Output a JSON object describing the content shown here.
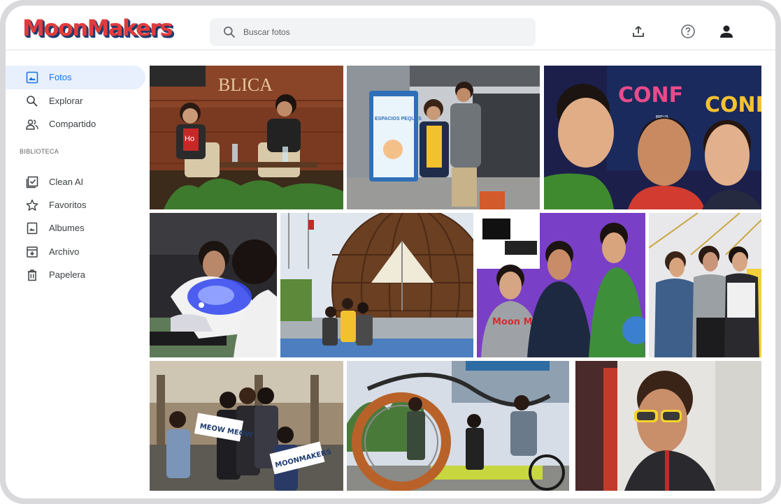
{
  "app": {
    "logo_text": "MoonMakers"
  },
  "search": {
    "placeholder": "Buscar fotos",
    "value": ""
  },
  "header_icons": [
    "upload-icon",
    "help-icon",
    "account-icon"
  ],
  "sidebar": {
    "primary": [
      {
        "label": "Fotos",
        "icon": "photo-icon",
        "active": true
      },
      {
        "label": "Explorar",
        "icon": "search-icon"
      },
      {
        "label": "Compartido",
        "icon": "people-icon"
      }
    ],
    "section_title": "BIBLIOTECA",
    "library": [
      {
        "label": "Clean AI",
        "icon": "checkbox-icon"
      },
      {
        "label": "Favoritos",
        "icon": "star-icon"
      },
      {
        "label": "Albumes",
        "icon": "album-icon"
      },
      {
        "label": "Archivo",
        "icon": "archive-icon"
      },
      {
        "label": "Papelera",
        "icon": "trash-icon"
      }
    ]
  },
  "photos": [
    {
      "scene": "stage-talk",
      "caption_sign": "BLICA",
      "shirt_text": "Ho"
    },
    {
      "scene": "kids-poster",
      "poster_title": "ESPACIOS PEQUES"
    },
    {
      "scene": "selfie-conf",
      "banner_text": "CONF",
      "sponsor": "BBVA"
    },
    {
      "scene": "lab-uv"
    },
    {
      "scene": "globe-dome"
    },
    {
      "scene": "purple-wall",
      "shirt_text": "Moon Makers"
    },
    {
      "scene": "three-friends"
    },
    {
      "scene": "courtyard-group",
      "sign_1": "MEOW MEOW",
      "sign_2": "MOONMAKERS"
    },
    {
      "scene": "ring-sculpture"
    },
    {
      "scene": "sunglasses-boy"
    }
  ],
  "colors": {
    "accent": "#1a73e8",
    "active_bg": "#e8f0fe",
    "logo_red": "#e23c3c",
    "logo_navy": "#1c3b6e"
  }
}
